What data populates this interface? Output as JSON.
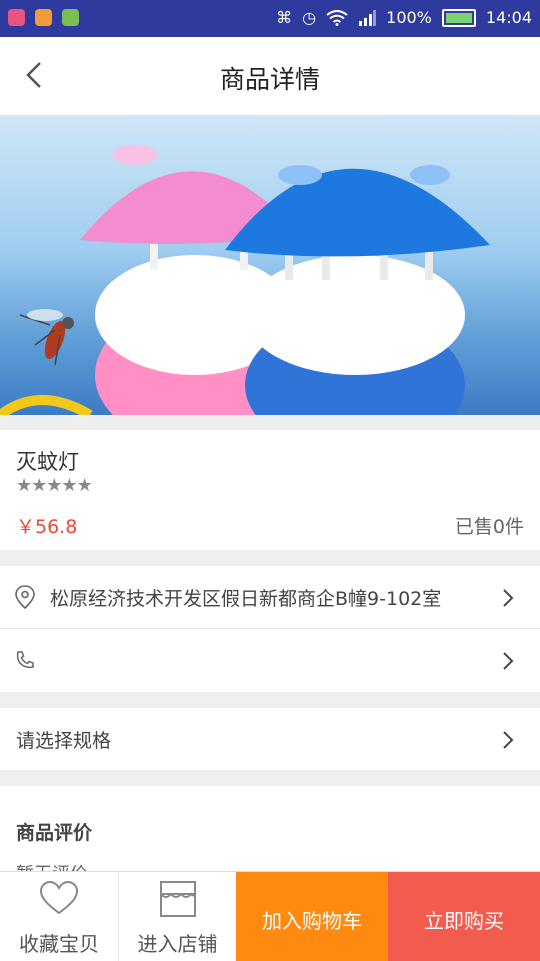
{
  "status_bar": {
    "battery": "100%",
    "time": "14:04"
  },
  "header": {
    "title": "商品详情",
    "back_icon": "chevron-left-icon"
  },
  "product": {
    "name": "灭蚊灯",
    "rating_stars": 5,
    "price": "￥56.8",
    "sold": "已售0件"
  },
  "address": {
    "text": "松原经济技术开发区假日新都商企B幢9-102室"
  },
  "phone": {
    "text": ""
  },
  "spec": {
    "label": "请选择规格"
  },
  "reviews": {
    "title": "商品评价",
    "empty_text": "暂无评价"
  },
  "bottom_bar": {
    "favorite_label": "收藏宝贝",
    "shop_label": "进入店铺",
    "add_cart_label": "加入购物车",
    "buy_now_label": "立即购买"
  },
  "colors": {
    "accent_orange": "#ff8a12",
    "accent_red": "#f25c4f",
    "price_red": "#e84b3a",
    "status_bar": "#2f3a9e"
  }
}
